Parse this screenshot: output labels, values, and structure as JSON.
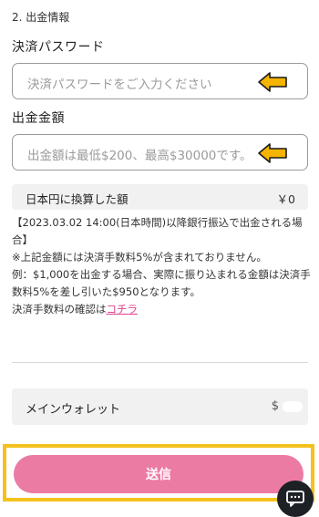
{
  "form": {
    "section_title": "2. 出金情報",
    "password_label": "決済パスワード",
    "password_placeholder": "決済パスワードをご入力ください",
    "amount_label": "出金金額",
    "amount_placeholder": "出金額は最低$200、最高$30000です。",
    "yen_label": "日本円に換算した額",
    "yen_value": "￥0"
  },
  "notes": {
    "line1": "【2023.03.02 14:00(日本時間)以降銀行振込で出金される場合】",
    "line2": "※上記金額には決済手数料5%が含まれておりません。",
    "line3": "例：$1,000を出金する場合、実際に振り込まれる金額は決済手数料5%を差し引いた$950となります。",
    "line4_prefix": "決済手数料の確認は",
    "line4_link": "コチラ"
  },
  "wallet": {
    "label": "メインウォレット",
    "currency": "$"
  },
  "submit": {
    "label": "送信"
  },
  "colors": {
    "accent_pink": "#ec7ba4",
    "highlight_yellow": "#f3c21d",
    "link_pink": "#e2408a"
  },
  "icons": [
    "arrow-left-icon",
    "chat-icon"
  ]
}
